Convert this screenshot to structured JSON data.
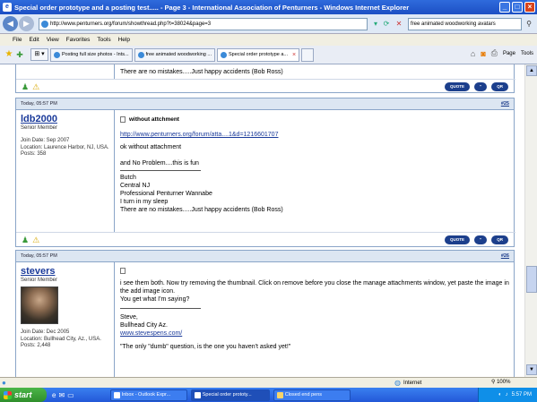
{
  "window": {
    "title": "Special order prototype and a posting test..... - Page 3 - International Association of Penturners - Windows Internet Explorer"
  },
  "address_bar": {
    "url": "http://www.penturners.org/forum/showthread.php?t=38024&page=3",
    "search_value": "free animated woodworking avatars"
  },
  "menu": [
    "File",
    "Edit",
    "View",
    "Favorites",
    "Tools",
    "Help"
  ],
  "tabs": [
    {
      "label": "Posting full size photos - Ints..."
    },
    {
      "label": "free animated woodworking ..."
    },
    {
      "label": "Special order prototype a..."
    }
  ],
  "command_bar": {
    "page_label": "Page",
    "tools_label": "Tools"
  },
  "post_top": {
    "signature_last": "There are no mistakes.....Just happy accidents (Bob Ross)",
    "buttons": [
      "QUOTE",
      "“",
      "QR"
    ]
  },
  "post_25": {
    "date": "Today, 05:57 PM",
    "number": "#25",
    "username": "ldb2000",
    "rank": "Senior Member",
    "join": "Join Date: Sep 2007",
    "location": "Location: Laurence Harbor, NJ, USA.",
    "posts": "Posts: 358",
    "title": "without attchment",
    "link": "http://www.penturners.org/forum/atta....1&d=1216601707",
    "line1": "ok without attachment",
    "line2": "and No Problem....this is fun",
    "sig1": "Butch",
    "sig2": "Central NJ",
    "sig3": "Professional Penturner Wannabe",
    "sig4": "I turn in my sleep",
    "sig5": "There are no mistakes.....Just happy accidents (Bob Ross)",
    "buttons": [
      "QUOTE",
      "“",
      "QR"
    ]
  },
  "post_26": {
    "date": "Today, 05:57 PM",
    "number": "#26",
    "username": "stevers",
    "rank": "Senior Member",
    "join": "Join Date: Dec 2005",
    "location": "Location: Bullhead City, Az., USA.",
    "posts": "Posts: 2,448",
    "line1": "i see them both. Now try removing the thumbnail. Click on remove before you close the manage attachments window, yet paste the image in the add image icon.",
    "line2": "You get what I'm saying?",
    "sig1": "Steve,",
    "sig2": "Bullhead City Az.",
    "sig3": "www.stevespens.com/",
    "quote": "\"The only \"dumb\" question, is the one you haven't asked yet!\""
  },
  "status_bar": {
    "zone": "Internet",
    "zoom": "100%"
  },
  "taskbar": {
    "start": "start",
    "tasks": [
      "Inbox - Outlook Expr...",
      "Special order prototy...",
      "Closed end pens"
    ],
    "clock": "5:57 PM"
  }
}
